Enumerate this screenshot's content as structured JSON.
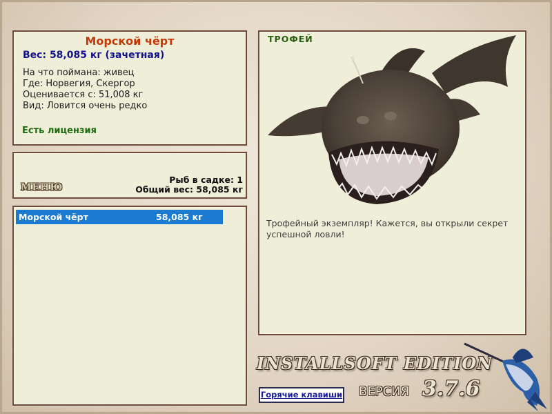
{
  "fish": {
    "name": "Морской чёрт",
    "weight_line": "Вес: 58,085 кг (зачетная)",
    "caught_with": "На что поймана: живец",
    "location": "Где: Норвегия, Скергор",
    "valued_from": "Оценивается с: 51,008 кг",
    "rarity": "Вид: Ловится очень редко",
    "license": "Есть лицензия"
  },
  "menu": {
    "label": "МЕНЮ",
    "fish_in_cage": "Рыб в садке: 1",
    "total_weight": "Общий вес: 58,085 кг"
  },
  "catch_list": [
    {
      "name": "Морской чёрт",
      "weight": "58,085 кг",
      "selected": true
    }
  ],
  "trophy": {
    "label": "ТРОФЕЙ",
    "message": "Трофейный экземпляр! Кажется, вы открыли секрет успешной ловли!",
    "image": "anglerfish-photo"
  },
  "footer": {
    "edition": "INSTALLSOFT EDITION",
    "version_word": "ВЕРСИЯ",
    "version_number": "3.7.6",
    "hotkeys": "Горячие клавиши",
    "logo": "marlin-logo"
  },
  "colors": {
    "title": "#c43a06",
    "weight": "#12128a",
    "license": "#1e6a10",
    "selection": "#1a7bd1",
    "panel_bg": "#efefd9",
    "panel_border": "#6b4a3a"
  }
}
